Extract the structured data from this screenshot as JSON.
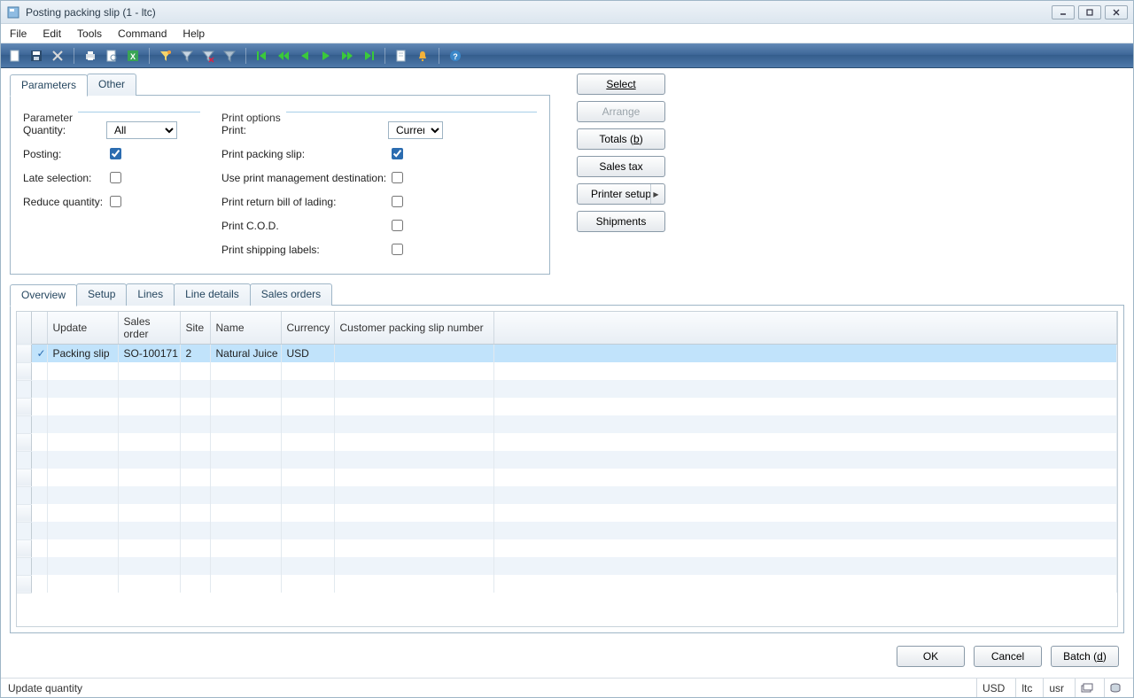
{
  "window": {
    "title": "Posting packing slip (1 - ltc)"
  },
  "menu": {
    "file": "File",
    "edit": "Edit",
    "tools": "Tools",
    "command": "Command",
    "help": "Help"
  },
  "topTabs": {
    "parameters": "Parameters",
    "other": "Other"
  },
  "parameterGroup": {
    "legend": "Parameter",
    "quantity_label": "Quantity:",
    "quantity_value": "All",
    "posting_label": "Posting:",
    "late_label": "Late selection:",
    "reduce_label": "Reduce quantity:"
  },
  "printGroup": {
    "legend": "Print options",
    "print_label": "Print:",
    "print_value": "Current",
    "slip_label": "Print packing slip:",
    "pm_label": "Use print management destination:",
    "bol_label": "Print return bill of lading:",
    "cod_label": "Print C.O.D.",
    "labels_label": "Print shipping labels:"
  },
  "sideButtons": {
    "select": "Select",
    "arrange": "Arrange",
    "totals_pre": "Totals (",
    "totals_accel": "b",
    "totals_post": ")",
    "sales_tax": "Sales tax",
    "printer_setup": "Printer setup",
    "shipments": "Shipments"
  },
  "gridTabs": {
    "overview": "Overview",
    "setup": "Setup",
    "lines": "Lines",
    "linedetails": "Line details",
    "salesorders": "Sales orders"
  },
  "gridHeaders": {
    "update": "Update",
    "sales_order": "Sales order",
    "site": "Site",
    "name": "Name",
    "currency": "Currency",
    "cust_slip": "Customer packing slip number"
  },
  "gridRows": [
    {
      "update": "Packing slip",
      "sales_order": "SO-100171",
      "site": "2",
      "name": "Natural Juice",
      "currency": "USD",
      "cust_slip": ""
    }
  ],
  "footer": {
    "ok": "OK",
    "cancel": "Cancel",
    "batch_pre": "Batch (",
    "batch_accel": "d",
    "batch_post": ")"
  },
  "status": {
    "text": "Update quantity",
    "currency": "USD",
    "company": "ltc",
    "user": "usr"
  }
}
